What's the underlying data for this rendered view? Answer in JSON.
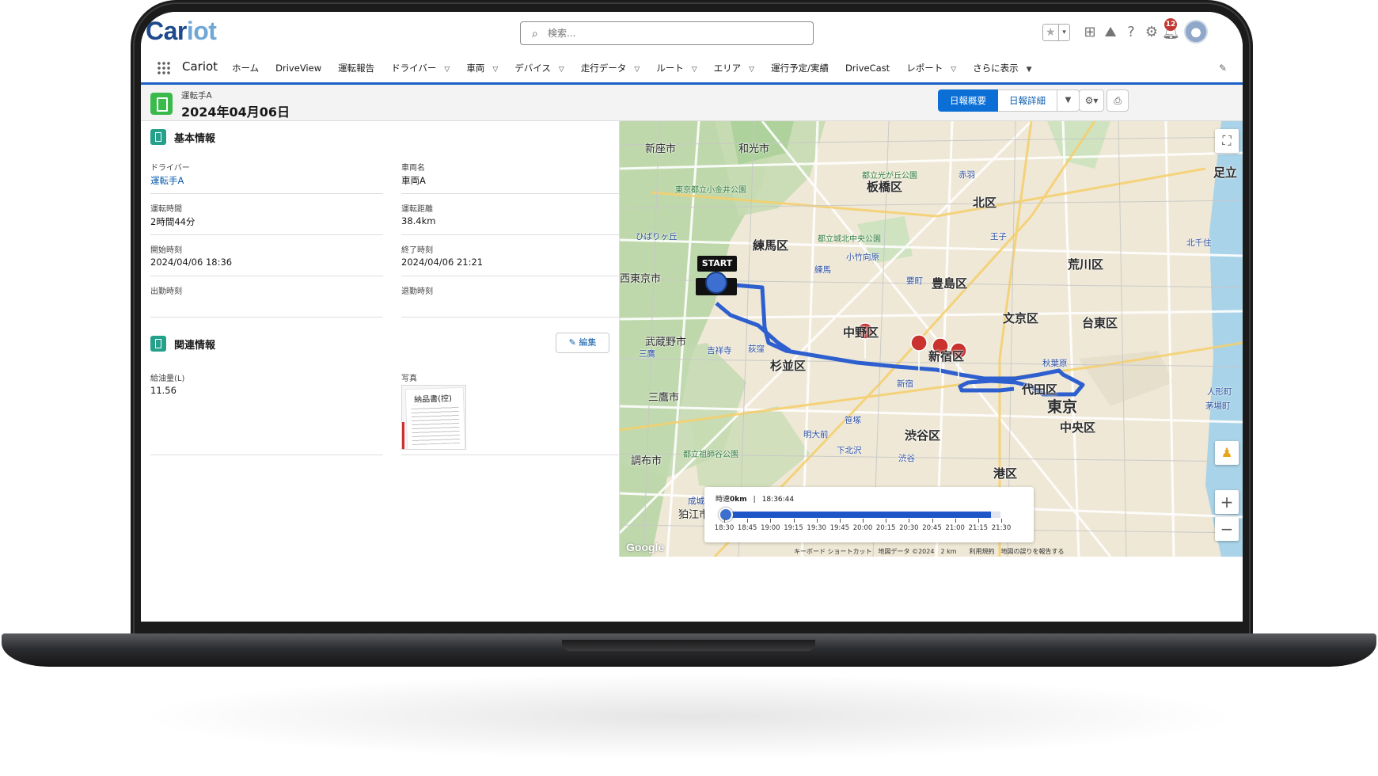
{
  "header": {
    "logo_part1": "Car",
    "logo_part2": "iot",
    "search_placeholder": "検索...",
    "notification_count": "12"
  },
  "nav": {
    "app_name": "Cariot",
    "items": [
      {
        "label": "ホーム",
        "dropdown": false
      },
      {
        "label": "DriveView",
        "dropdown": false
      },
      {
        "label": "運転報告",
        "dropdown": false
      },
      {
        "label": "ドライバー",
        "dropdown": true
      },
      {
        "label": "車両",
        "dropdown": true
      },
      {
        "label": "デバイス",
        "dropdown": true
      },
      {
        "label": "走行データ",
        "dropdown": true
      },
      {
        "label": "ルート",
        "dropdown": true
      },
      {
        "label": "エリア",
        "dropdown": true
      },
      {
        "label": "運行予定/実績",
        "dropdown": false
      },
      {
        "label": "DriveCast",
        "dropdown": false
      },
      {
        "label": "レポート",
        "dropdown": true
      },
      {
        "label": "さらに表示",
        "dropdown": true
      }
    ]
  },
  "record": {
    "object_label": "運転手A",
    "title": "2024年04月06日",
    "buttons": {
      "summary": "日報概要",
      "detail": "日報詳細"
    }
  },
  "basic_info": {
    "section_title": "基本情報",
    "fields": {
      "driver": {
        "label": "ドライバー",
        "value": "運転手A"
      },
      "vehicle": {
        "label": "車両名",
        "value": "車両A"
      },
      "drive_time": {
        "label": "運転時間",
        "value": "2時間44分"
      },
      "distance": {
        "label": "運転距離",
        "value": "38.4km"
      },
      "start_time": {
        "label": "開始時刻",
        "value": "2024/04/06 18:36"
      },
      "end_time": {
        "label": "終了時刻",
        "value": "2024/04/06 21:21"
      },
      "clock_in": {
        "label": "出勤時刻",
        "value": ""
      },
      "clock_out": {
        "label": "退勤時刻",
        "value": ""
      }
    }
  },
  "related_info": {
    "section_title": "関連情報",
    "edit_label": "編集",
    "fuel": {
      "label": "給油量(L)",
      "value": "11.56"
    },
    "photo": {
      "label": "写真",
      "receipt_title": "納品書(控)"
    }
  },
  "map": {
    "labels": {
      "nerima": "練馬区",
      "itabashi": "板橋区",
      "kita": "北区",
      "toshima": "豊島区",
      "nakano": "中野区",
      "shinjuku": "新宿区",
      "suginami": "杉並区",
      "shibuya": "渋谷区",
      "bunkyo": "文京区",
      "taito": "台東区",
      "arakawa": "荒川区",
      "chiyoda": "代田区",
      "chuo": "中央区",
      "minato": "港区",
      "tokyo": "東京",
      "adachi": "足立",
      "musashino": "武蔵野市",
      "mitaka": "三鷹市",
      "chofu": "調布市",
      "komae": "狛江市",
      "nishitokyo": "西東京市",
      "niiza": "新座市",
      "wako": "和光市",
      "shinjuku_st": "新宿",
      "shibuya_st": "渋谷",
      "akihabara": "秋葉原",
      "kichijoji": "吉祥寺",
      "hibarigaoka": "ひばりヶ丘",
      "ogikubo": "荻窪",
      "nerima_st": "練馬",
      "ikebukuro_ku": "要町",
      "oji": "王子",
      "akabane": "赤羽",
      "kitasenju": "北千住",
      "shimokitazawa": "下北沢",
      "meidaimae": "明大前",
      "sasazuka": "笹塚",
      "kotakemukai": "小竹向原",
      "mitaka_st": "三鷹",
      "seijo": "成城",
      "ningyocho": "人形町",
      "kayabacho": "茅場町",
      "park_fukuyama": "都立光が丘公園",
      "park_higashikurume": "東京都立小金井公園",
      "park_jindai": "都立祖師谷公園",
      "park_nerima": "都立城北中央公園"
    },
    "copyright": "キーボード ショートカット　地図データ ©2024　2 km　　利用規約　地図の誤りを報告する",
    "google": "Google",
    "start": "START"
  },
  "timeline": {
    "speed_prefix": "時速",
    "speed_value": "0km",
    "separator": "|",
    "current_time": "18:36:44",
    "ticks": [
      "18:30",
      "18:45",
      "19:00",
      "19:15",
      "19:30",
      "19:45",
      "20:00",
      "20:15",
      "20:30",
      "20:45",
      "21:00",
      "21:15",
      "21:30"
    ],
    "progress_fraction": 0.965
  },
  "colors": {
    "brand_dark": "#1d4a8b",
    "brand_light": "#6fa7d6",
    "accent": "#0b6fd6",
    "route": "#3d6fd1",
    "marker": "#c9322f"
  }
}
